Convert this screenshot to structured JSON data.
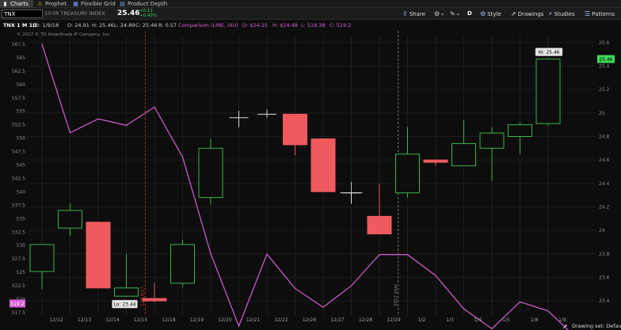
{
  "tabs": [
    {
      "label": "Charts",
      "icon": "chart-icon",
      "active": true
    },
    {
      "label": "Prophet",
      "icon": "warning-icon",
      "active": false
    },
    {
      "label": "Flexible Grid",
      "icon": "grid-icon",
      "active": false
    },
    {
      "label": "Product Depth",
      "icon": "depth-icon",
      "active": false
    }
  ],
  "toolbar": {
    "symbol": "TNX",
    "description": "10-YR TREASURY INDEX",
    "last_price": "25.46",
    "change": "+0.11",
    "change_pct": "+0.43%",
    "change_color": "#3fd65a",
    "buttons": {
      "share": "Share",
      "interval": "D",
      "style": "Style",
      "drawings": "Drawings",
      "studies": "Studies",
      "patterns": "Patterns"
    }
  },
  "legend": {
    "symbol": "TNX 1 M 1D",
    "date": "D: 1/9/18",
    "open": "O: 24.91",
    "high": "H: 25.46",
    "low": "L: 24.89",
    "close": "C: 25.46",
    "range": "R: 0.57",
    "comparison_label": "Comparison (LINE, IXU)",
    "comp_open": "O: $24.25",
    "comp_high": "H: $24.48",
    "comp_low": "L: 518.38",
    "comp_close": "C: 519.2",
    "comparison_color": "#d760d7",
    "copyright": "© 2017 © TD Ameritrade IP Company, Inc."
  },
  "chart_data": {
    "type": "line",
    "title": "",
    "xlabel": "",
    "ylabel": "",
    "x": [
      "12/12",
      "12/13",
      "12/14",
      "12/15",
      "12/18",
      "12/19",
      "12/20",
      "12/21",
      "12/22",
      "12/26",
      "12/27",
      "12/28",
      "12/29",
      "1/2",
      "1/3",
      "1/4",
      "1/5",
      "1/8",
      "1/9"
    ],
    "tick_labels": [
      "12/12",
      "12/13",
      "12/14",
      "12/15",
      "12/18",
      "12/19",
      "12/20",
      "12/21",
      "12/22",
      "12/26",
      "12/27",
      "12/28",
      "12/29",
      "1/2",
      "1/3",
      "1/4",
      "1/5",
      "1/8",
      "1/9"
    ],
    "candles": {
      "name": "TNX",
      "open": [
        23.65,
        24.02,
        24.07,
        23.44,
        23.42,
        23.55,
        24.28,
        24.96,
        24.99,
        24.99,
        24.78,
        24.32,
        24.12,
        24.32,
        24.6,
        24.55,
        24.7,
        24.8,
        24.91
      ],
      "high": [
        23.65,
        24.23,
        24.07,
        23.8,
        23.55,
        23.92,
        24.78,
        25.02,
        25.03,
        24.99,
        24.78,
        24.32,
        24.4,
        24.88,
        24.6,
        24.94,
        24.88,
        24.92,
        25.46
      ],
      "low": [
        23.5,
        23.95,
        23.51,
        23.44,
        23.39,
        23.52,
        24.22,
        24.88,
        24.96,
        24.64,
        24.34,
        24.24,
        23.97,
        24.28,
        24.55,
        24.55,
        24.42,
        24.65,
        24.89
      ],
      "close": [
        23.88,
        24.17,
        23.51,
        23.51,
        23.4,
        23.88,
        24.7,
        24.96,
        24.99,
        24.73,
        24.33,
        24.32,
        23.97,
        24.65,
        24.58,
        24.74,
        24.83,
        24.9,
        25.46
      ],
      "up_color": "#39b54a",
      "down_color": "#f05a5f",
      "doji_color": "#d9d9d9"
    },
    "comparison": {
      "name": "IXU",
      "values": [
        567.5,
        551,
        553.6,
        552.4,
        555.8,
        546.5,
        528.5,
        515,
        528.4,
        522,
        518.5,
        522.5,
        528.3,
        528.3,
        524.4,
        518.2,
        514.5,
        519.5,
        517.8,
        512.8
      ],
      "color": "#d760d7"
    },
    "left_axis": {
      "ylim": [
        517.5,
        570
      ],
      "ticks": [
        567.5,
        565,
        562.5,
        560,
        557.5,
        555,
        552.5,
        550,
        547.5,
        545,
        542.5,
        540,
        537.5,
        535,
        532.5,
        530,
        527.5,
        525,
        522.5,
        520,
        517.5
      ],
      "labels": [
        "567.5",
        "565",
        "562.5",
        "560",
        "557.5",
        "555",
        "552.5",
        "550",
        "547.5",
        "545",
        "542.5",
        "540",
        "537.5",
        "535",
        "532.5",
        "530",
        "527.5",
        "525",
        "522.5",
        "520",
        "517.5"
      ],
      "current": "519.2"
    },
    "right_axis": {
      "ylim": [
        23.3,
        25.7
      ],
      "ticks": [
        25.6,
        25.4,
        25.2,
        25.0,
        24.8,
        24.6,
        24.4,
        24.2,
        24.0,
        23.8,
        23.6,
        23.4
      ],
      "labels": [
        "25.6",
        "25.4",
        "25.2",
        "25",
        "24.8",
        "24.6",
        "24.4",
        "24.2",
        "24",
        "23.8",
        "23.6",
        "23.4"
      ],
      "current": "25.46",
      "current_color": "#3fd65a"
    },
    "annotations": {
      "high_label": "Hi: 25.46",
      "low_label": "Lo: 23.44",
      "low_index": 3,
      "low_value": 23.44,
      "high_index": 18,
      "high_value": 25.46,
      "markers": [
        {
          "text": "12/18/17",
          "after_index": 3,
          "color": "#c0392b"
        },
        {
          "text": "2017 year",
          "after_index": 12,
          "color": "#8a8a8a"
        }
      ]
    },
    "grid": true,
    "footer": {
      "status": "Drawing set: Default"
    }
  }
}
